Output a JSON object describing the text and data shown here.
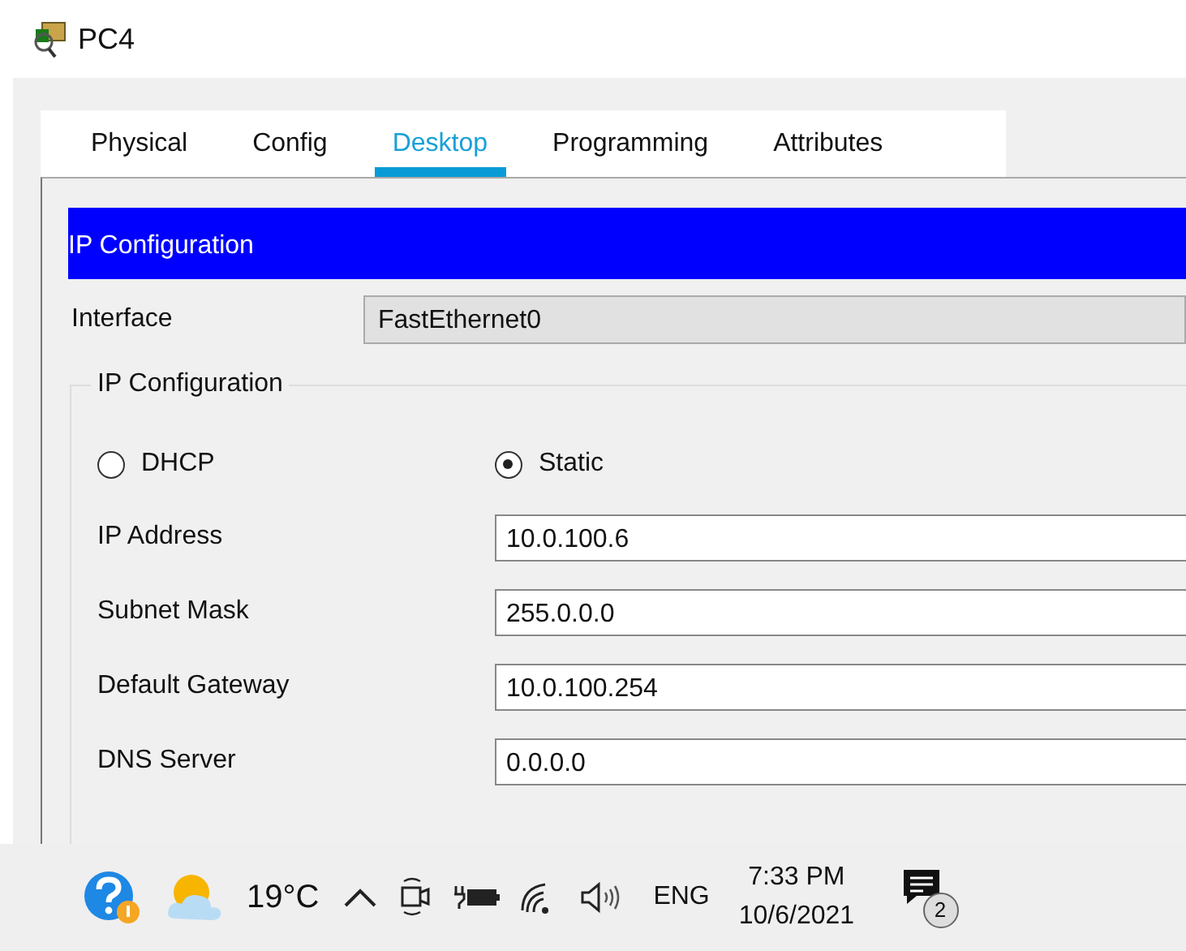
{
  "window": {
    "title": "PC4"
  },
  "tabs": [
    {
      "label": "Physical",
      "selected": false
    },
    {
      "label": "Config",
      "selected": false
    },
    {
      "label": "Desktop",
      "selected": true
    },
    {
      "label": "Programming",
      "selected": false
    },
    {
      "label": "Attributes",
      "selected": false
    }
  ],
  "panel": {
    "header": "IP Configuration",
    "interface_label": "Interface",
    "interface_value": "FastEthernet0",
    "group": {
      "legend": "IP Configuration",
      "modes": [
        {
          "label": "DHCP",
          "selected": false
        },
        {
          "label": "Static",
          "selected": true
        }
      ],
      "fields": [
        {
          "label": "IP Address",
          "value": "10.0.100.6"
        },
        {
          "label": "Subnet Mask",
          "value": "255.0.0.0"
        },
        {
          "label": "Default Gateway",
          "value": "10.0.100.254"
        },
        {
          "label": "DNS Server",
          "value": "0.0.0.0"
        }
      ]
    }
  },
  "taskbar": {
    "temperature": "19°C",
    "language": "ENG",
    "time": "7:33 PM",
    "date": "10/6/2021",
    "notification_count": "2"
  }
}
